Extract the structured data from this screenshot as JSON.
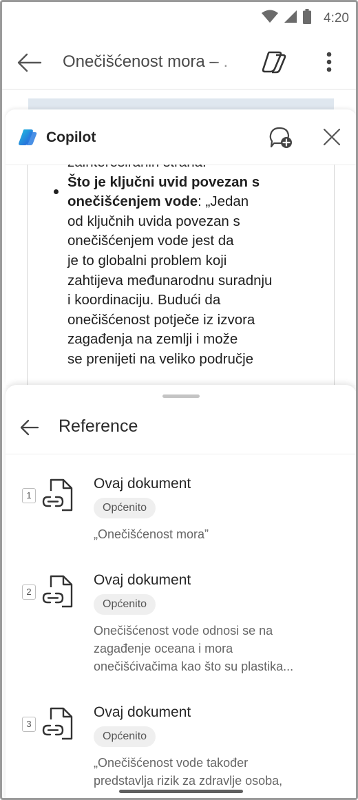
{
  "status_bar": {
    "time": "4:20",
    "icons": [
      "wifi-icon",
      "cellular-signal-icon",
      "battery-icon"
    ]
  },
  "app_bar": {
    "title": "Onečišćenost mora – .",
    "icons": [
      "back-arrow-icon",
      "copilot-toggle-icon",
      "more-vert-icon"
    ]
  },
  "copilot": {
    "title": "Copilot",
    "icons": [
      "copilot-logo-icon",
      "new-chat-icon",
      "close-icon"
    ],
    "chat": {
      "lines": [
        {
          "parts": [
            {
              "text": "zainteresiranih strana.",
              "bold": false
            }
          ]
        },
        {
          "parts": [
            {
              "text": "Što je ključni uvid povezan s",
              "bold": true
            }
          ]
        },
        {
          "parts": [
            {
              "text": "onečišćenjem vode",
              "bold": true
            },
            {
              "text": ": „Jedan",
              "bold": false
            }
          ]
        },
        {
          "parts": [
            {
              "text": "od ključnih uvida povezan s",
              "bold": false
            }
          ]
        },
        {
          "parts": [
            {
              "text": "onečišćenjem vode jest da",
              "bold": false
            }
          ]
        },
        {
          "parts": [
            {
              "text": "je to globalni problem koji",
              "bold": false
            }
          ]
        },
        {
          "parts": [
            {
              "text": "zahtijeva međunarodnu suradnju",
              "bold": false
            }
          ]
        },
        {
          "parts": [
            {
              "text": "i koordinaciju. Budući da",
              "bold": false
            }
          ]
        },
        {
          "parts": [
            {
              "text": "onečišćenost potječe iz izvora",
              "bold": false
            }
          ]
        },
        {
          "parts": [
            {
              "text": "zagađenja na zemlji i može",
              "bold": false
            }
          ]
        },
        {
          "parts": [
            {
              "text": "se prenijeti na veliko područje",
              "bold": false
            }
          ]
        }
      ]
    }
  },
  "references": {
    "title": "Reference",
    "items": [
      {
        "number": "1",
        "name": "Ovaj dokument",
        "badge": "Općenito",
        "excerpt": [
          "„Onečišćenost mora”"
        ]
      },
      {
        "number": "2",
        "name": "Ovaj dokument",
        "badge": "Općenito",
        "excerpt": [
          "Onečišćenost vode odnosi se na",
          "zagađenje oceana i mora",
          "onečišćivačima kao što su plastika..."
        ]
      },
      {
        "number": "3",
        "name": "Ovaj dokument",
        "badge": "Općenito",
        "excerpt": [
          "„Onečišćenost vode također",
          "predstavlja rizik za zdravlje osoba,"
        ]
      }
    ]
  },
  "colors": {
    "copilot_blue": "#2a7de1",
    "copilot_cyan": "#1fc3e0",
    "text_primary": "#1f1f1f",
    "text_secondary": "#666666"
  }
}
